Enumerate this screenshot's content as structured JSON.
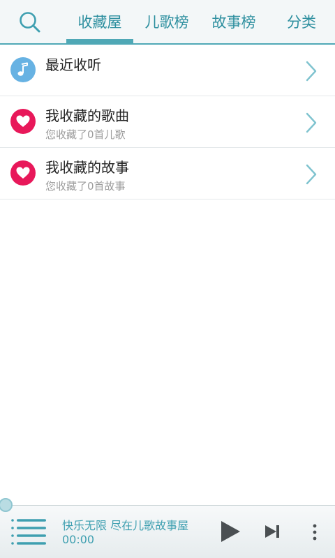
{
  "nav": {
    "tabs": [
      {
        "label": "收藏屋",
        "active": true
      },
      {
        "label": "儿歌榜",
        "active": false
      },
      {
        "label": "故事榜",
        "active": false
      },
      {
        "label": "分类",
        "active": false
      }
    ],
    "search_icon": "search-icon",
    "accent_color": "#4fa8b6"
  },
  "list": {
    "items": [
      {
        "title": "最近收听",
        "subtitle": "",
        "icon": "music-note-icon",
        "icon_color": "#67b2e3"
      },
      {
        "title": "我收藏的歌曲",
        "subtitle": "您收藏了0首儿歌",
        "icon": "heart-icon",
        "icon_color": "#e8185a"
      },
      {
        "title": "我收藏的故事",
        "subtitle": "您收藏了0首故事",
        "icon": "heart-icon",
        "icon_color": "#e8185a"
      }
    ]
  },
  "player": {
    "title": "快乐无限 尽在儿歌故事屋",
    "time": "00:00",
    "progress": 0
  }
}
